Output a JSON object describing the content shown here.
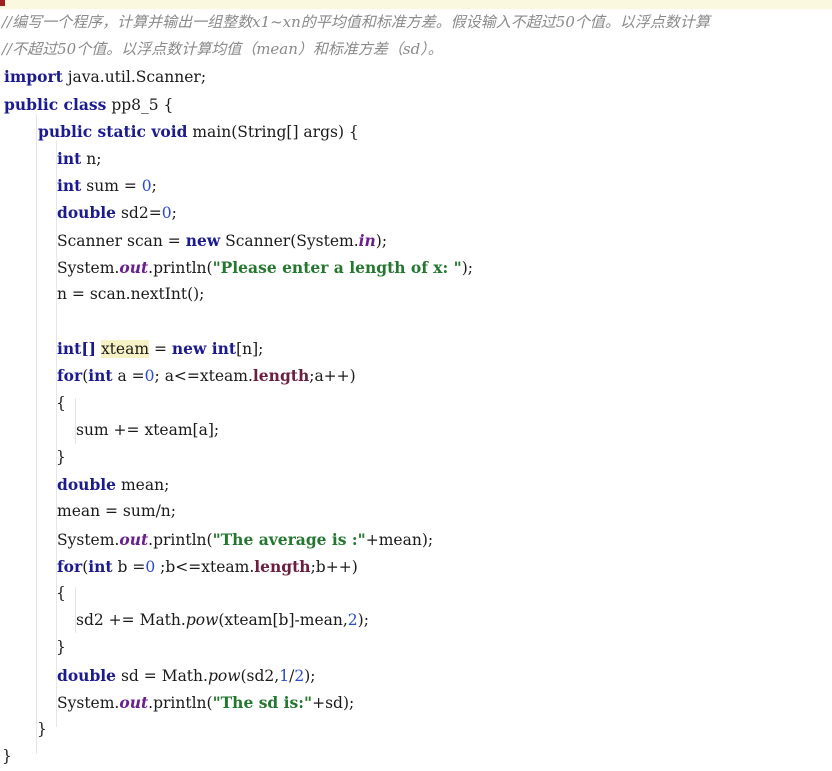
{
  "editor": {
    "language": "java",
    "class_name": "pp8_5",
    "colors": {
      "background": "#ffffff",
      "keyword": "#1b1b8f",
      "string": "#24772f",
      "number": "#2a4bd0",
      "comment": "#8a8a8a",
      "field": "#6b1f8c",
      "length_member": "#6b1f3f",
      "occurrence_highlight": "#f7f2c6",
      "current_line_highlight": "#fbf8e0",
      "indent_guide": "#e6e6ea",
      "caret_error_mark": "#a02020"
    },
    "highlighted_token": "xteam"
  },
  "comments": {
    "line1": "//编写一个程序，计算并输出一组整数x1~xn的平均值和标准方差。假设输入不超过50个值。以浮点数计算",
    "line2": "//不超过50个值。以浮点数计算均值（mean）和标准方差（sd）。"
  },
  "code": {
    "l_import_kw": "import",
    "l_import_rest": " java.util.Scanner;",
    "l_class_kw": "public class",
    "l_class_rest": " pp8_5 {",
    "l_main_kw": "public static void",
    "l_main_rest": " main(String[] args) {",
    "l_int_n_kw": "int",
    "l_int_n_rest": " n;",
    "l_int_sum_kw": "int",
    "l_int_sum_mid": " sum = ",
    "l_int_sum_num": "0",
    "l_int_sum_end": ";",
    "l_double_sd2_kw": "double",
    "l_double_sd2_mid": " sd2=",
    "l_double_sd2_num": "0",
    "l_double_sd2_end": ";",
    "l_scanner_a": "Scanner scan = ",
    "l_scanner_kw": "new",
    "l_scanner_b": " Scanner(System.",
    "l_scanner_field": "in",
    "l_scanner_c": ");",
    "l_print1_a": "System.",
    "l_print1_field": "out",
    "l_print1_b": ".println(",
    "l_print1_str": "\"Please enter a length of x: \"",
    "l_print1_c": ");",
    "l_nextint": "n = scan.nextInt();",
    "l_blank1": "",
    "l_arr_kw": "int[]",
    "l_arr_sp1": " ",
    "l_arr_name": "xteam",
    "l_arr_mid": " = ",
    "l_arr_kw2": "new int",
    "l_arr_end": "[n];",
    "l_for_a_kw": "for",
    "l_for_a_p1": "(",
    "l_for_a_kw2": "int",
    "l_for_a_p2": " a =",
    "l_for_a_num": "0",
    "l_for_a_p3": "; a<=xteam.",
    "l_for_a_len": "length",
    "l_for_a_p4": ";a++)",
    "l_brace_open1": "{",
    "l_sum_add": "sum += xteam[a];",
    "l_brace_close1": "}",
    "l_double_mean_kw": "double",
    "l_double_mean_rest": " mean;",
    "l_mean_assign": "mean = sum/n;",
    "l_print2_a": "System.",
    "l_print2_field": "out",
    "l_print2_b": ".println(",
    "l_print2_str": "\"The average is :\"",
    "l_print2_c": "+mean);",
    "l_for_b_kw": "for",
    "l_for_b_p1": "(",
    "l_for_b_kw2": "int",
    "l_for_b_p2": " b =",
    "l_for_b_num": "0",
    "l_for_b_p3": " ;b<=xteam.",
    "l_for_b_len": "length",
    "l_for_b_p4": ";b++)",
    "l_brace_open2": "{",
    "l_sd2_a": "sd2 += Math.",
    "l_sd2_pow": "pow",
    "l_sd2_b": "(xteam[b]-mean,",
    "l_sd2_num": "2",
    "l_sd2_c": ");",
    "l_brace_close2": "}",
    "l_sd_kw": "double",
    "l_sd_a": " sd = Math.",
    "l_sd_pow": "pow",
    "l_sd_b": "(sd2,",
    "l_sd_num1": "1",
    "l_sd_slash": "/",
    "l_sd_num2": "2",
    "l_sd_c": ");",
    "l_print3_a": "System.",
    "l_print3_field": "out",
    "l_print3_b": ".println(",
    "l_print3_str": "\"The sd is:\"",
    "l_print3_c": "+sd);",
    "l_brace_close_main": "}",
    "l_brace_close_class": "}"
  }
}
